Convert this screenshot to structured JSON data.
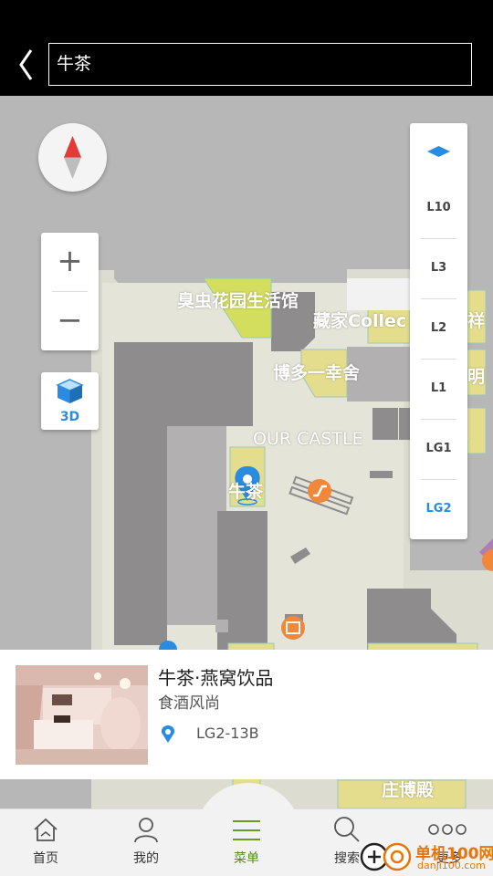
{
  "header": {
    "search_value": "牛茶",
    "back_icon": "chevron-left-icon"
  },
  "map": {
    "labels": {
      "garden": "臭虫花园生活馆",
      "collection": "藏家Collec",
      "right_edge_1": "祥",
      "hakata": "博多一幸舍",
      "right_edge_2": "明",
      "castle": "OUR CASTLE",
      "niucha": "牛茶",
      "bottom": "庄博殿"
    },
    "zoom_in": "+",
    "zoom_out": "−",
    "view_3d": "3D",
    "floors": [
      "L10",
      "L3",
      "L2",
      "L1",
      "LG1",
      "LG2"
    ],
    "active_floor": "LG2",
    "accent_color": "#2a8ce0"
  },
  "card": {
    "title": "牛茶·燕窝饮品",
    "category": "食酒风尚",
    "location": "LG2-13B"
  },
  "tabs": [
    {
      "label": "首页",
      "icon": "home-icon"
    },
    {
      "label": "我的",
      "icon": "user-icon"
    },
    {
      "label": "菜单",
      "icon": "menu-icon",
      "active": true
    },
    {
      "label": "搜索",
      "icon": "search-icon"
    },
    {
      "label": "更多",
      "icon": "more-icon"
    }
  ],
  "watermark": {
    "text": "单机100网",
    "url": "danji100.com"
  }
}
